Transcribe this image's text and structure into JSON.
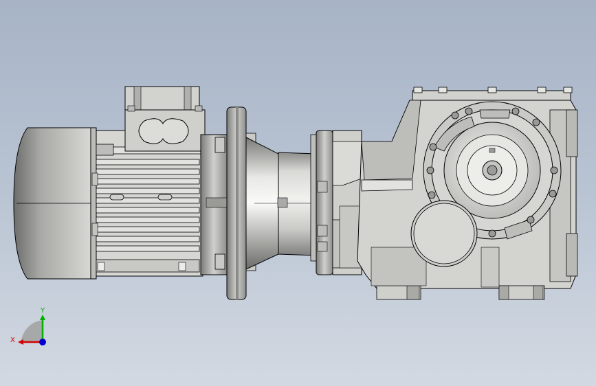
{
  "viewport": {
    "background_top": "#a7b4c6",
    "background_bottom": "#d3d9e2"
  },
  "model": {
    "description_name": "gear-motor-assembly",
    "body_color": "#d4d4d1",
    "shadow_color": "#8a8a88",
    "outline_color": "#000000"
  },
  "triad": {
    "x_label": "X",
    "y_label": "Y",
    "x_color": "#d40000",
    "y_color": "#00b000",
    "z_color": "#0000d0"
  }
}
